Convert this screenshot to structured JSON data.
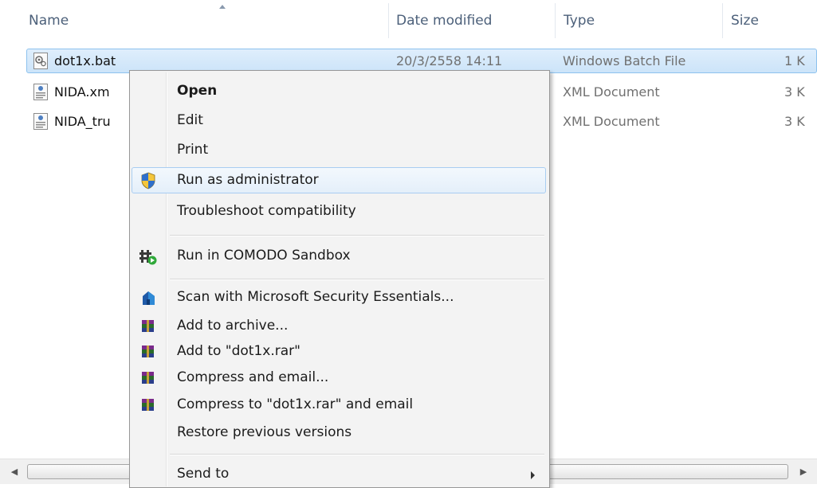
{
  "columns": {
    "name": "Name",
    "date_modified": "Date modified",
    "type": "Type",
    "size": "Size"
  },
  "files": [
    {
      "name": "dot1x.bat",
      "date": "20/3/2558 14:11",
      "type": "Windows Batch File",
      "size": "1 K",
      "icon": "batch-file-icon",
      "selected": true
    },
    {
      "name": "NIDA.xm",
      "date": "",
      "type": "XML Document",
      "size": "3 K",
      "icon": "xml-file-icon",
      "selected": false
    },
    {
      "name": "NIDA_tru",
      "date": "",
      "type": "XML Document",
      "size": "3 K",
      "icon": "xml-file-icon",
      "selected": false
    }
  ],
  "context_menu": {
    "items": [
      {
        "label": "Open",
        "bold": true,
        "icon": ""
      },
      {
        "label": "Edit",
        "icon": ""
      },
      {
        "label": "Print",
        "icon": ""
      },
      {
        "label": "Run as administrator",
        "icon": "uac-shield-icon",
        "hovered": true
      },
      {
        "label": "Troubleshoot compatibility",
        "icon": ""
      },
      {
        "label": "Run in COMODO Sandbox",
        "icon": "comodo-sandbox-icon"
      },
      {
        "label": "Scan with Microsoft Security Essentials...",
        "icon": "security-essentials-icon"
      },
      {
        "label": "Add to archive...",
        "icon": "winrar-icon"
      },
      {
        "label": "Add to \"dot1x.rar\"",
        "icon": "winrar-icon"
      },
      {
        "label": "Compress and email...",
        "icon": "winrar-icon"
      },
      {
        "label": "Compress to \"dot1x.rar\" and email",
        "icon": "winrar-icon"
      },
      {
        "label": "Restore previous versions",
        "icon": ""
      },
      {
        "label": "Send to",
        "icon": "",
        "submenu": true
      }
    ]
  },
  "colors": {
    "selection_fill": "#cce4f9",
    "selection_border": "#8dc2ee",
    "menu_background": "#f3f3f3",
    "menu_hover_border": "#a8cdf1",
    "header_text": "#4c607a",
    "secondary_text": "#707070"
  }
}
